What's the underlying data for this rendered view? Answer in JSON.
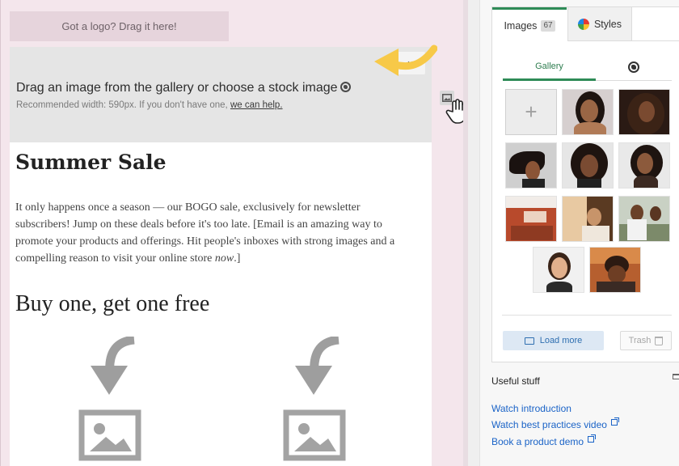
{
  "canvas": {
    "logo_drop_label": "Got a logo? Drag it here!",
    "close_label": "×",
    "banner_title": "Drag an image from the gallery or choose a stock image",
    "banner_sub_prefix": "Recommended width: 590px. If you don't have one, ",
    "banner_sub_link": "we can help.",
    "heading": "Summer Sale",
    "paragraph_before_italic": "It only happens once a season — our BOGO sale, exclusively for newsletter subscribers! Jump on these deals before it's too late. [Email is an amazing way to promote your products and offerings. Hit people's inboxes with strong images and a compelling reason to visit your online store ",
    "paragraph_italic": "now",
    "paragraph_after_italic": ".]",
    "subheading": "Buy one, get one free"
  },
  "panel": {
    "tab_images_label": "Images",
    "tab_images_count": "67",
    "tab_styles_label": "Styles",
    "subtab_gallery_label": "Gallery",
    "add_tile_label": "+",
    "load_more_label": "Load more",
    "trash_label": "Trash",
    "useful_heading": "Useful stuff",
    "links": [
      "Watch introduction",
      "Watch best practices video",
      "Book a product demo"
    ]
  },
  "icons": [
    "globe-icon",
    "image-icon",
    "hand-cursor-icon",
    "curved-arrow-icon",
    "palette-icon",
    "trash-icon",
    "external-link-icon",
    "collapse-icon",
    "image-placeholder-icon",
    "down-arrow-icon"
  ],
  "colors": {
    "accent_green": "#2e8b57",
    "link_blue": "#1a63c7",
    "highlight_yellow": "#f7c948"
  }
}
